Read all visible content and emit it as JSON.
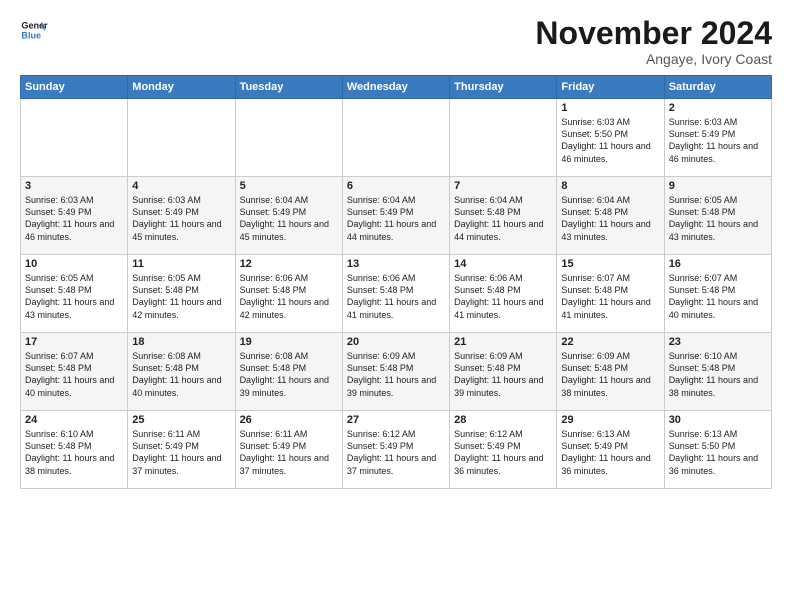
{
  "logo": {
    "line1": "General",
    "line2": "Blue"
  },
  "title": "November 2024",
  "subtitle": "Angaye, Ivory Coast",
  "days_header": [
    "Sunday",
    "Monday",
    "Tuesday",
    "Wednesday",
    "Thursday",
    "Friday",
    "Saturday"
  ],
  "weeks": [
    [
      {
        "num": "",
        "text": ""
      },
      {
        "num": "",
        "text": ""
      },
      {
        "num": "",
        "text": ""
      },
      {
        "num": "",
        "text": ""
      },
      {
        "num": "",
        "text": ""
      },
      {
        "num": "1",
        "text": "Sunrise: 6:03 AM\nSunset: 5:50 PM\nDaylight: 11 hours and 46 minutes."
      },
      {
        "num": "2",
        "text": "Sunrise: 6:03 AM\nSunset: 5:49 PM\nDaylight: 11 hours and 46 minutes."
      }
    ],
    [
      {
        "num": "3",
        "text": "Sunrise: 6:03 AM\nSunset: 5:49 PM\nDaylight: 11 hours and 46 minutes."
      },
      {
        "num": "4",
        "text": "Sunrise: 6:03 AM\nSunset: 5:49 PM\nDaylight: 11 hours and 45 minutes."
      },
      {
        "num": "5",
        "text": "Sunrise: 6:04 AM\nSunset: 5:49 PM\nDaylight: 11 hours and 45 minutes."
      },
      {
        "num": "6",
        "text": "Sunrise: 6:04 AM\nSunset: 5:49 PM\nDaylight: 11 hours and 44 minutes."
      },
      {
        "num": "7",
        "text": "Sunrise: 6:04 AM\nSunset: 5:48 PM\nDaylight: 11 hours and 44 minutes."
      },
      {
        "num": "8",
        "text": "Sunrise: 6:04 AM\nSunset: 5:48 PM\nDaylight: 11 hours and 43 minutes."
      },
      {
        "num": "9",
        "text": "Sunrise: 6:05 AM\nSunset: 5:48 PM\nDaylight: 11 hours and 43 minutes."
      }
    ],
    [
      {
        "num": "10",
        "text": "Sunrise: 6:05 AM\nSunset: 5:48 PM\nDaylight: 11 hours and 43 minutes."
      },
      {
        "num": "11",
        "text": "Sunrise: 6:05 AM\nSunset: 5:48 PM\nDaylight: 11 hours and 42 minutes."
      },
      {
        "num": "12",
        "text": "Sunrise: 6:06 AM\nSunset: 5:48 PM\nDaylight: 11 hours and 42 minutes."
      },
      {
        "num": "13",
        "text": "Sunrise: 6:06 AM\nSunset: 5:48 PM\nDaylight: 11 hours and 41 minutes."
      },
      {
        "num": "14",
        "text": "Sunrise: 6:06 AM\nSunset: 5:48 PM\nDaylight: 11 hours and 41 minutes."
      },
      {
        "num": "15",
        "text": "Sunrise: 6:07 AM\nSunset: 5:48 PM\nDaylight: 11 hours and 41 minutes."
      },
      {
        "num": "16",
        "text": "Sunrise: 6:07 AM\nSunset: 5:48 PM\nDaylight: 11 hours and 40 minutes."
      }
    ],
    [
      {
        "num": "17",
        "text": "Sunrise: 6:07 AM\nSunset: 5:48 PM\nDaylight: 11 hours and 40 minutes."
      },
      {
        "num": "18",
        "text": "Sunrise: 6:08 AM\nSunset: 5:48 PM\nDaylight: 11 hours and 40 minutes."
      },
      {
        "num": "19",
        "text": "Sunrise: 6:08 AM\nSunset: 5:48 PM\nDaylight: 11 hours and 39 minutes."
      },
      {
        "num": "20",
        "text": "Sunrise: 6:09 AM\nSunset: 5:48 PM\nDaylight: 11 hours and 39 minutes."
      },
      {
        "num": "21",
        "text": "Sunrise: 6:09 AM\nSunset: 5:48 PM\nDaylight: 11 hours and 39 minutes."
      },
      {
        "num": "22",
        "text": "Sunrise: 6:09 AM\nSunset: 5:48 PM\nDaylight: 11 hours and 38 minutes."
      },
      {
        "num": "23",
        "text": "Sunrise: 6:10 AM\nSunset: 5:48 PM\nDaylight: 11 hours and 38 minutes."
      }
    ],
    [
      {
        "num": "24",
        "text": "Sunrise: 6:10 AM\nSunset: 5:48 PM\nDaylight: 11 hours and 38 minutes."
      },
      {
        "num": "25",
        "text": "Sunrise: 6:11 AM\nSunset: 5:49 PM\nDaylight: 11 hours and 37 minutes."
      },
      {
        "num": "26",
        "text": "Sunrise: 6:11 AM\nSunset: 5:49 PM\nDaylight: 11 hours and 37 minutes."
      },
      {
        "num": "27",
        "text": "Sunrise: 6:12 AM\nSunset: 5:49 PM\nDaylight: 11 hours and 37 minutes."
      },
      {
        "num": "28",
        "text": "Sunrise: 6:12 AM\nSunset: 5:49 PM\nDaylight: 11 hours and 36 minutes."
      },
      {
        "num": "29",
        "text": "Sunrise: 6:13 AM\nSunset: 5:49 PM\nDaylight: 11 hours and 36 minutes."
      },
      {
        "num": "30",
        "text": "Sunrise: 6:13 AM\nSunset: 5:50 PM\nDaylight: 11 hours and 36 minutes."
      }
    ]
  ]
}
